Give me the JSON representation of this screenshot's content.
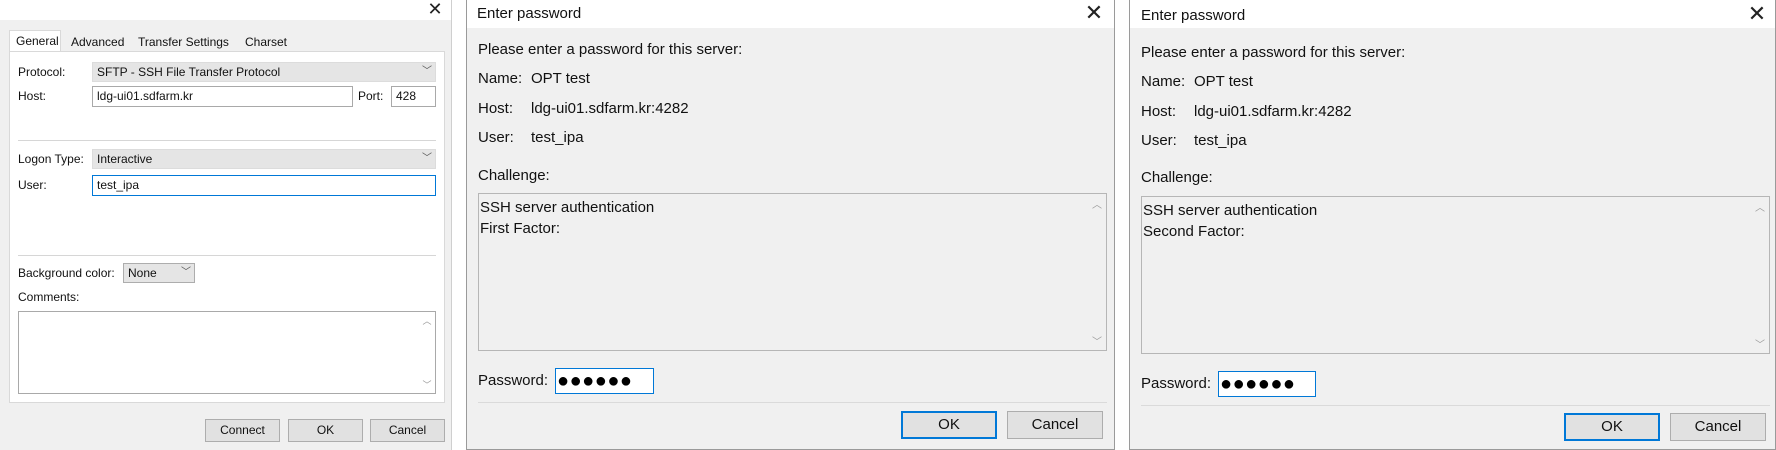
{
  "site_manager": {
    "tabs": [
      "General",
      "Advanced",
      "Transfer Settings",
      "Charset"
    ],
    "protocol_label": "Protocol:",
    "protocol_value": "SFTP - SSH File Transfer Protocol",
    "host_label": "Host:",
    "host_value": "ldg-ui01.sdfarm.kr",
    "port_label": "Port:",
    "port_value": "428",
    "logon_type_label": "Logon Type:",
    "logon_type_value": "Interactive",
    "user_label": "User:",
    "user_value": "test_ipa",
    "bg_color_label": "Background color:",
    "bg_color_value": "None",
    "comments_label": "Comments:",
    "buttons": {
      "connect": "Connect",
      "ok": "OK",
      "cancel": "Cancel"
    }
  },
  "dialogs": [
    {
      "title": "Enter password",
      "prompt": "Please enter a password for this server:",
      "name_label": "Name:",
      "name_value": "OPT test",
      "host_label": "Host:",
      "host_value": "ldg-ui01.sdfarm.kr:4282",
      "user_label": "User:",
      "user_value": "test_ipa",
      "challenge_label": "Challenge:",
      "challenge_lines": [
        "SSH server authentication",
        "First Factor:"
      ],
      "password_label": "Password:",
      "password_mask": "●●●●●●",
      "ok": "OK",
      "cancel": "Cancel"
    },
    {
      "title": "Enter password",
      "prompt": "Please enter a password for this server:",
      "name_label": "Name:",
      "name_value": "OPT test",
      "host_label": "Host:",
      "host_value": "ldg-ui01.sdfarm.kr:4282",
      "user_label": "User:",
      "user_value": "test_ipa",
      "challenge_label": "Challenge:",
      "challenge_lines": [
        "SSH server authentication",
        "Second Factor:"
      ],
      "password_label": "Password:",
      "password_mask": "●●●●●●",
      "ok": "OK",
      "cancel": "Cancel"
    }
  ]
}
